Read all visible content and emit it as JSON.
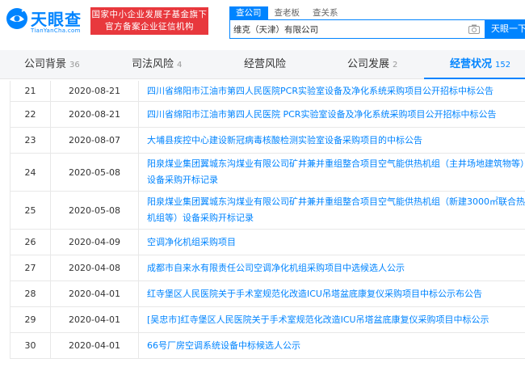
{
  "header": {
    "logo_text": "天眼查",
    "logo_sub": "TianYanCha.com",
    "slogan_line1": "国家中小企业发展子基金旗下",
    "slogan_line2": "官方备案企业征信机构",
    "search_tabs": [
      "查公司",
      "查老板",
      "查关系"
    ],
    "search_value": "维克（天津）有限公司",
    "search_button": "天眼一下"
  },
  "nav": {
    "items": [
      {
        "label": "公司背景",
        "count": "36"
      },
      {
        "label": "司法风险",
        "count": "4"
      },
      {
        "label": "经营风险",
        "count": ""
      },
      {
        "label": "公司发展",
        "count": "2"
      },
      {
        "label": "经营状况",
        "count": "152"
      }
    ]
  },
  "rows": [
    {
      "idx": "21",
      "date": "2020-08-21",
      "title": "四川省绵阳市江油市第四人民医院PCR实验室设备及净化系统采购项目公开招标中标公告"
    },
    {
      "idx": "22",
      "date": "2020-08-21",
      "title": "四川省绵阳市江油市第四人民医院 PCR实验室设备及净化系统采购项目公开招标中标公告"
    },
    {
      "idx": "23",
      "date": "2020-08-07",
      "title": "大埔县疾控中心建设新冠病毒核酸检测实验室设备采购项目的中标公告"
    },
    {
      "idx": "24",
      "date": "2020-05-08",
      "title": "阳泉煤业集团翼城东沟煤业有限公司矿井兼并重组整合项目空气能供热机组（主井场地建筑物等）设备采购开标记录"
    },
    {
      "idx": "25",
      "date": "2020-05-08",
      "title": "阳泉煤业集团翼城东沟煤业有限公司矿井兼并重组整合项目空气能供热机组（新建3000㎡联合热机组等）设备采购开标记录"
    },
    {
      "idx": "26",
      "date": "2020-04-09",
      "title": "空调净化机组采购项目"
    },
    {
      "idx": "27",
      "date": "2020-04-08",
      "title": "成都市自来水有限责任公司空调净化机组采购项目中选候选人公示"
    },
    {
      "idx": "28",
      "date": "2020-04-01",
      "title": "红寺堡区人民医院关于手术室规范化改造ICU吊塔盆底康复仪采购项目中标公示布公告"
    },
    {
      "idx": "29",
      "date": "2020-04-01",
      "title": "[吴忠市]红寺堡区人民医院关于手术室规范化改造ICU吊塔盆底康复仪采购项目中标公示"
    },
    {
      "idx": "30",
      "date": "2020-04-01",
      "title": "66号厂房空调系统设备中标候选人公示"
    }
  ]
}
